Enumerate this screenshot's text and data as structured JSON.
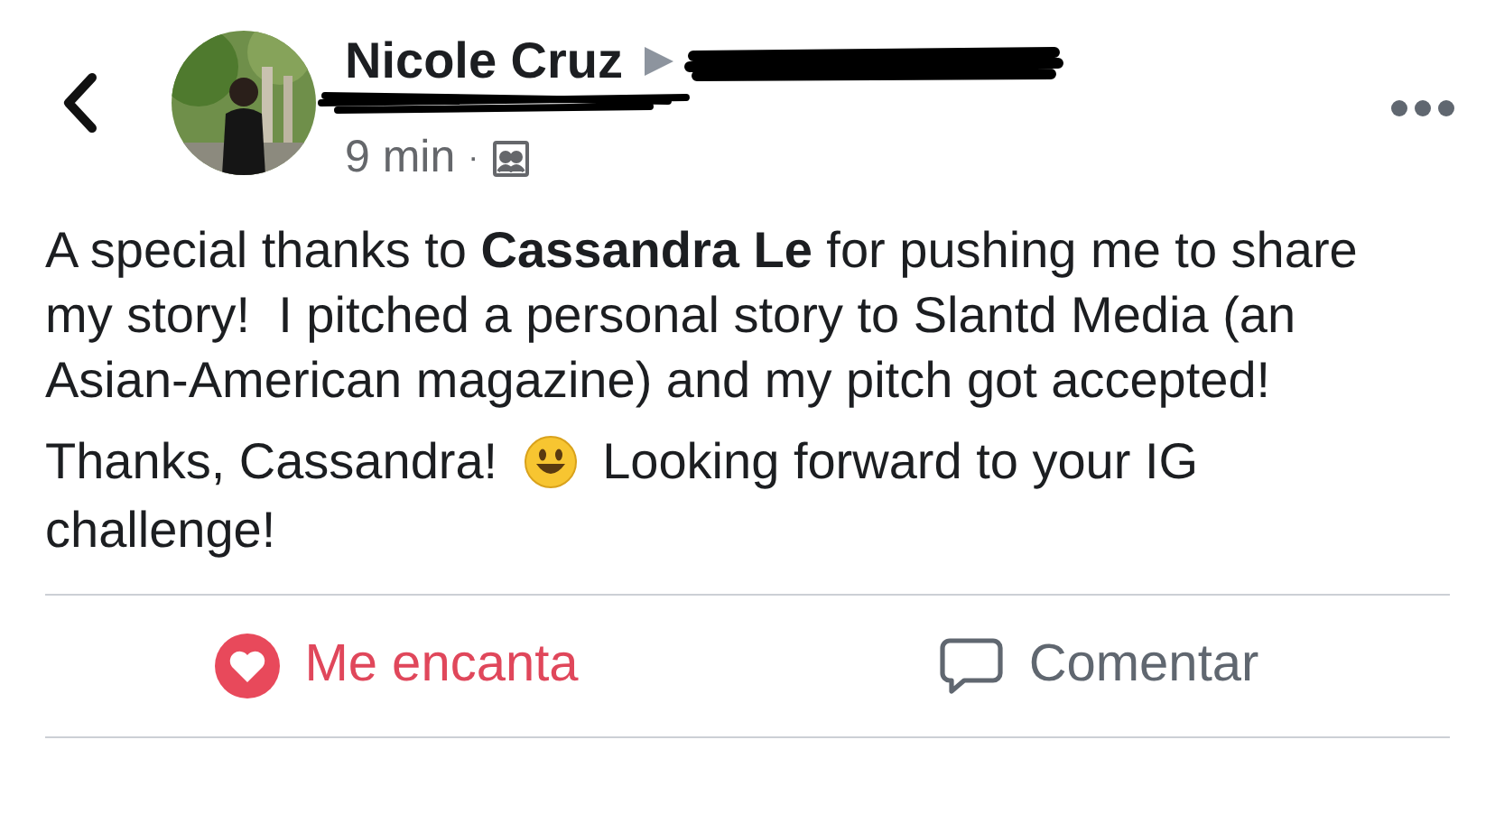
{
  "post": {
    "author": "Nicole Cruz",
    "time": "9 min",
    "separator": "·",
    "paragraphs": [
      "A special thanks to **Cassandra Le** for pushing me to share my story!  I pitched a personal story to Slantd Media (an Asian-American magazine) and my pitch got accepted!"
    ],
    "closing": {
      "before": "Thanks, Cassandra!",
      "after": [
        "Looking forward to your IG",
        "challenge!"
      ]
    }
  },
  "actions": [
    {
      "kind": "love",
      "label": "Me encanta",
      "selected": true
    },
    {
      "kind": "comment",
      "label": "Comentar",
      "selected": false
    }
  ]
}
